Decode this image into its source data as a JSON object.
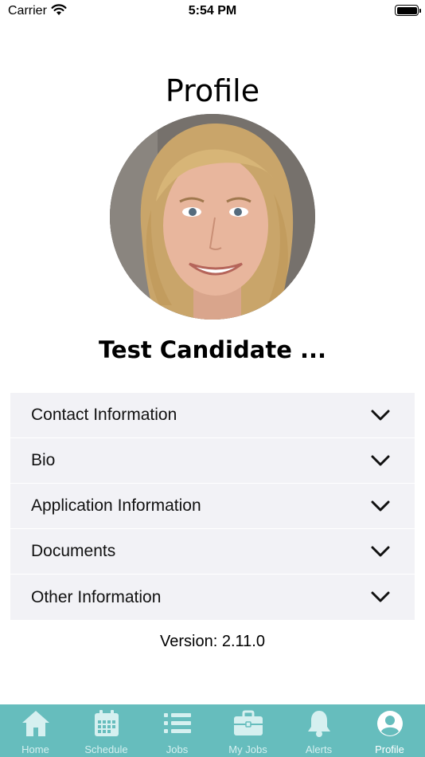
{
  "status_bar": {
    "carrier": "Carrier",
    "time": "5:54 PM"
  },
  "page": {
    "title": "Profile",
    "candidate_name": "Test Candidate ..."
  },
  "sections": [
    {
      "label": "Contact Information",
      "icon": "chevron-down-icon"
    },
    {
      "label": "Bio",
      "icon": "chevron-down-icon"
    },
    {
      "label": "Application Information",
      "icon": "chevron-down-icon"
    },
    {
      "label": "Documents",
      "icon": "chevron-down-icon"
    },
    {
      "label": "Other Information",
      "icon": "chevron-down-icon"
    }
  ],
  "version": "Version: 2.11.0",
  "tab_bar": {
    "active": "Profile",
    "tabs": [
      {
        "label": "Home",
        "icon": "home-icon"
      },
      {
        "label": "Schedule",
        "icon": "calendar-icon"
      },
      {
        "label": "Jobs",
        "icon": "list-icon"
      },
      {
        "label": "My Jobs",
        "icon": "briefcase-icon"
      },
      {
        "label": "Alerts",
        "icon": "bell-icon"
      },
      {
        "label": "Profile",
        "icon": "user-circle-icon"
      }
    ]
  },
  "colors": {
    "tab_bar_bg": "#66bdbd",
    "section_bg": "#f2f2f6",
    "tab_active": "#ffffff",
    "tab_inactive": "#d6f0f0"
  }
}
